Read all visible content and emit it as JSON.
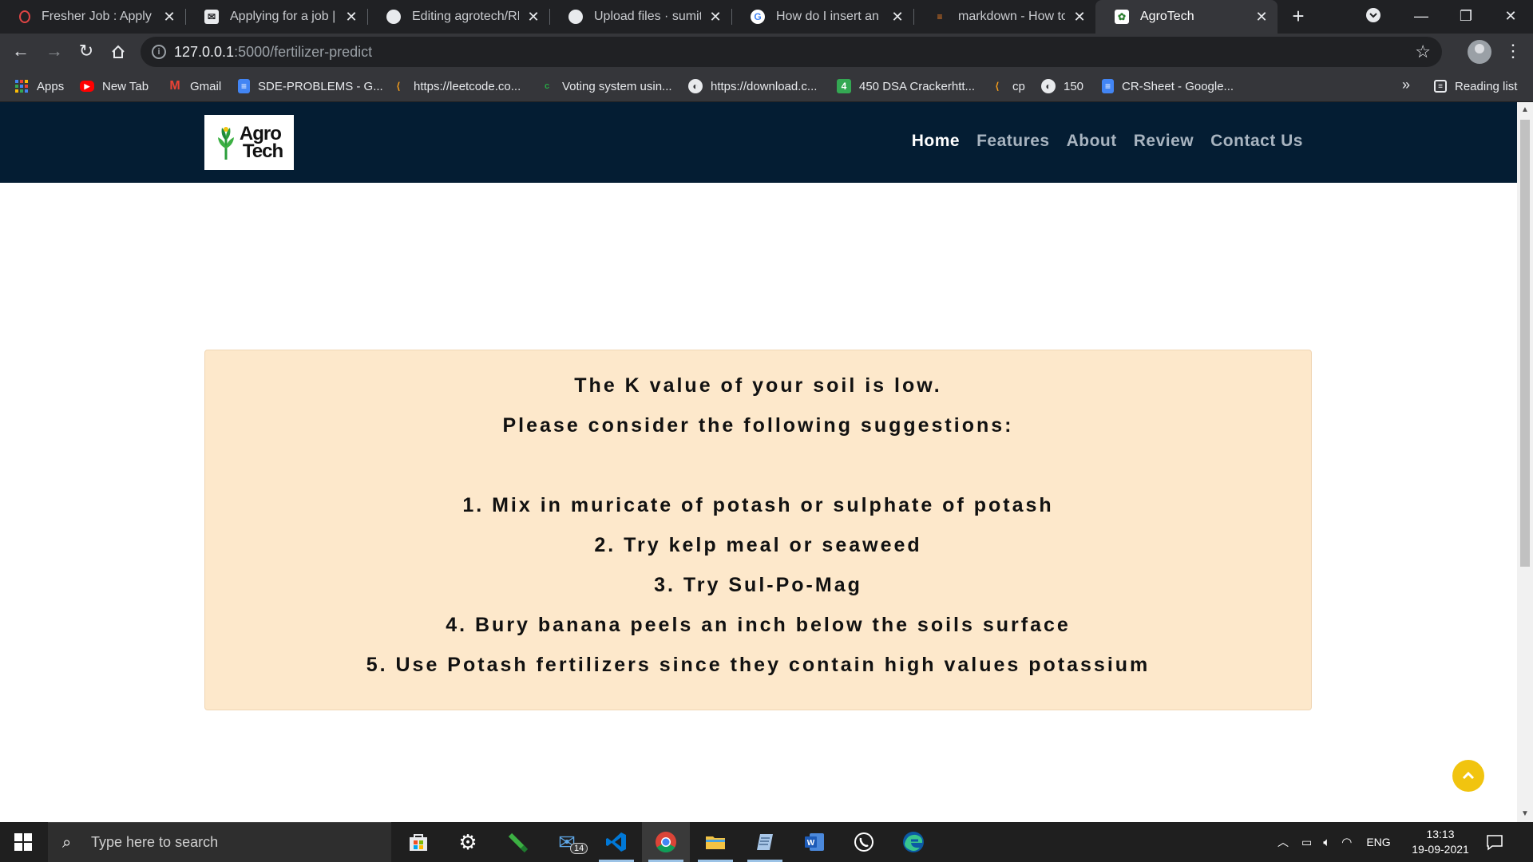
{
  "browser": {
    "tabs": [
      {
        "title": "Fresher Job : Apply for",
        "favicon": "opera-icon",
        "color": "#e04545"
      },
      {
        "title": "Applying for a job | M",
        "favicon": "mail-icon",
        "color": "#e8eaed"
      },
      {
        "title": "Editing agrotech/REA",
        "favicon": "github-icon",
        "color": "#e8eaed"
      },
      {
        "title": "Upload files · sumitga",
        "favicon": "github-icon",
        "color": "#e8eaed"
      },
      {
        "title": "How do I insert an ima",
        "favicon": "google-icon",
        "color": "#4285f4"
      },
      {
        "title": "markdown - How to a",
        "favicon": "stackoverflow-icon",
        "color": "#f48024"
      },
      {
        "title": "AgroTech",
        "favicon": "agrotech-icon",
        "color": "#ffffff",
        "active": true
      }
    ],
    "url_host": "127.0.0.1",
    "url_path": ":5000/fertilizer-predict",
    "bookmarks": [
      {
        "label": "Apps",
        "icon": "apps-grid-icon",
        "color": "#4285f4"
      },
      {
        "label": "New Tab",
        "icon": "youtube-icon",
        "color": "#ff0000"
      },
      {
        "label": "Gmail",
        "icon": "gmail-icon",
        "color": "#ea4335"
      },
      {
        "label": "SDE-PROBLEMS - G...",
        "icon": "docs-icon",
        "color": "#4285f4"
      },
      {
        "label": "https://leetcode.co...",
        "icon": "leetcode-icon",
        "color": "#f89f1b"
      },
      {
        "label": "Voting system usin...",
        "icon": "c-icon",
        "color": "#28a745"
      },
      {
        "label": "https://download.c...",
        "icon": "globe-icon",
        "color": "#e8eaed"
      },
      {
        "label": "450 DSA Crackerhtt...",
        "icon": "four-icon",
        "color": "#34a853"
      },
      {
        "label": "cp",
        "icon": "leetcode-icon",
        "color": "#f89f1b"
      },
      {
        "label": "150",
        "icon": "globe-icon",
        "color": "#e8eaed"
      },
      {
        "label": "CR-Sheet - Google...",
        "icon": "docs-icon",
        "color": "#4285f4"
      }
    ],
    "reading_list": "Reading list",
    "more": "»"
  },
  "page": {
    "logo_text": [
      "Agro",
      "Tech"
    ],
    "nav": [
      {
        "label": "Home",
        "active": true
      },
      {
        "label": "Features"
      },
      {
        "label": "About"
      },
      {
        "label": "Review"
      },
      {
        "label": "Contact Us"
      }
    ],
    "result": {
      "heading": "The K value of your soil is low.",
      "subheading": "Please consider the following suggestions:",
      "suggestions": [
        "1. Mix in muricate of potash or sulphate of potash",
        "2. Try kelp meal or seaweed",
        "3. Try Sul-Po-Mag",
        "4. Bury banana peels an inch below the soils surface",
        "5. Use Potash fertilizers since they contain high values potassium"
      ]
    },
    "colors": {
      "navbar": "#041d33",
      "result_bg": "#fde8cb",
      "back_to_top": "#f1c40f"
    }
  },
  "taskbar": {
    "search_placeholder": "Type here to search",
    "mail_badge": "14",
    "language": "ENG",
    "time": "13:13",
    "date": "19-09-2021"
  }
}
